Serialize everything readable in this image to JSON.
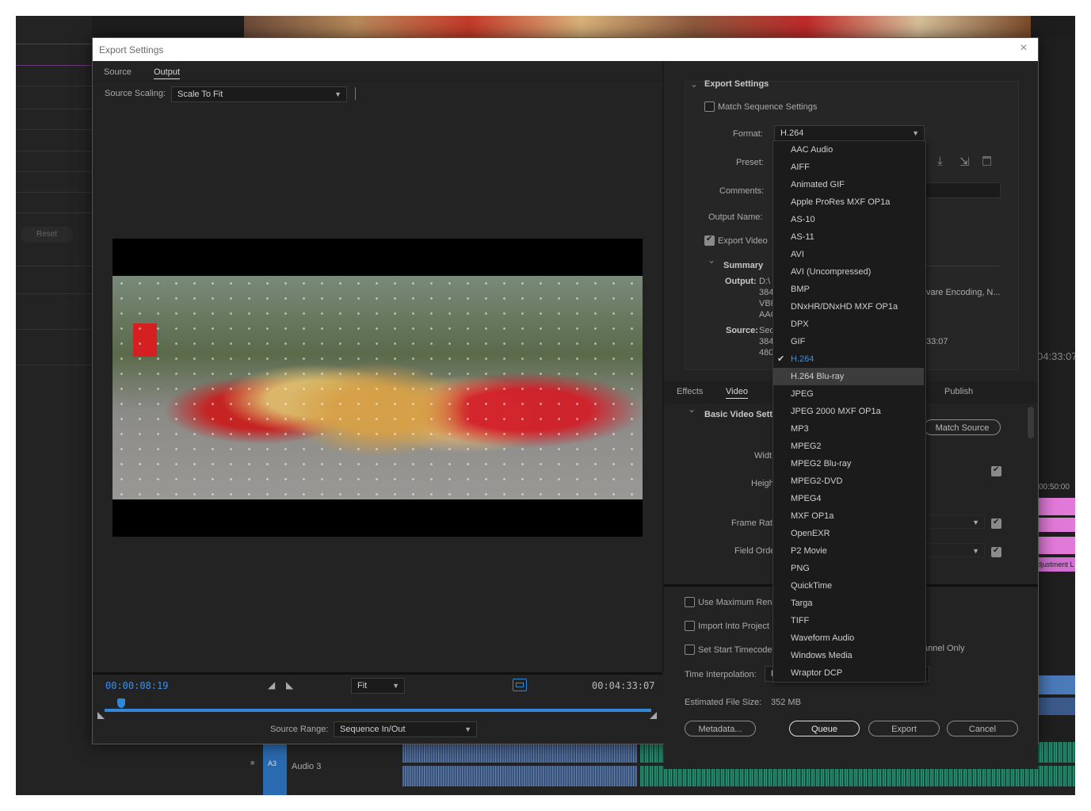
{
  "dialog": {
    "title": "Export Settings",
    "close_icon": "×"
  },
  "left": {
    "tabs": [
      "Source",
      "Output"
    ],
    "active_tab": "Output",
    "source_scaling_label": "Source Scaling:",
    "source_scaling_value": "Scale To Fit",
    "timecode_current": "00:00:08:19",
    "timecode_duration": "00:04:33:07",
    "zoom_value": "Fit",
    "source_range_label": "Source Range:",
    "source_range_value": "Sequence In/Out"
  },
  "export_settings": {
    "header": "Export Settings",
    "match_sequence_label": "Match Sequence Settings",
    "format_label": "Format:",
    "format_value": "H.264",
    "preset_label": "Preset:",
    "comments_label": "Comments:",
    "output_name_label": "Output Name:",
    "export_video_label": "Export Video",
    "summary_header": "Summary",
    "output_label": "Output:",
    "output_lines": [
      "D:\\",
      "384",
      "VBF",
      "AAC"
    ],
    "output_tail": "vare Encoding, N...",
    "source_label": "Source:",
    "source_lines": [
      "Seq",
      "384",
      "480"
    ],
    "source_tail": "33:07"
  },
  "tabs2": [
    "Effects",
    "Video",
    "Publish"
  ],
  "active_tab2": "Video",
  "video": {
    "basic_header": "Basic Video Setti",
    "match_source_button": "Match Source",
    "width_label": "Widt",
    "height_label": "Heigh",
    "frame_rate_label": "Frame Rat",
    "field_order_label": "Field Orde"
  },
  "bottom": {
    "use_max_render_label": "Use Maximum Ren",
    "import_into_project_label": "Import Into Project",
    "set_start_timecode_label": "Set Start Timecode",
    "alpha_only_tail": "annel Only",
    "time_interpolation_label": "Time Interpolation:",
    "time_interpolation_value": "F",
    "estimated_size_label": "Estimated File Size:",
    "estimated_size_value": "352 MB",
    "metadata_button": "Metadata...",
    "queue_button": "Queue",
    "export_button": "Export",
    "cancel_button": "Cancel"
  },
  "format_menu": {
    "items": [
      "AAC Audio",
      "AIFF",
      "Animated GIF",
      "Apple ProRes MXF OP1a",
      "AS-10",
      "AS-11",
      "AVI",
      "AVI (Uncompressed)",
      "BMP",
      "DNxHR/DNxHD MXF OP1a",
      "DPX",
      "GIF",
      "H.264",
      "H.264 Blu-ray",
      "JPEG",
      "JPEG 2000 MXF OP1a",
      "MP3",
      "MPEG2",
      "MPEG2 Blu-ray",
      "MPEG2-DVD",
      "MPEG4",
      "MXF OP1a",
      "OpenEXR",
      "P2 Movie",
      "PNG",
      "QuickTime",
      "Targa",
      "TIFF",
      "Waveform Audio",
      "Windows Media",
      "Wraptor DCP"
    ],
    "selected": "H.264",
    "hovered": "H.264 Blu-ray"
  },
  "background": {
    "reset_button": "Reset",
    "timecode_right": "04:33:07",
    "ruler_time": "00:50:00",
    "adjustment_label": "djustment L",
    "track_id": "A3",
    "track_name": "Audio 3",
    "fx_label": "fx"
  },
  "icons": {
    "checkmark": "✔",
    "chevron": "⌄",
    "download": "⤓",
    "import": "⇲",
    "trash": "🗑",
    "lock": "🔒",
    "mark_in": "◢",
    "mark_out": "◣"
  }
}
